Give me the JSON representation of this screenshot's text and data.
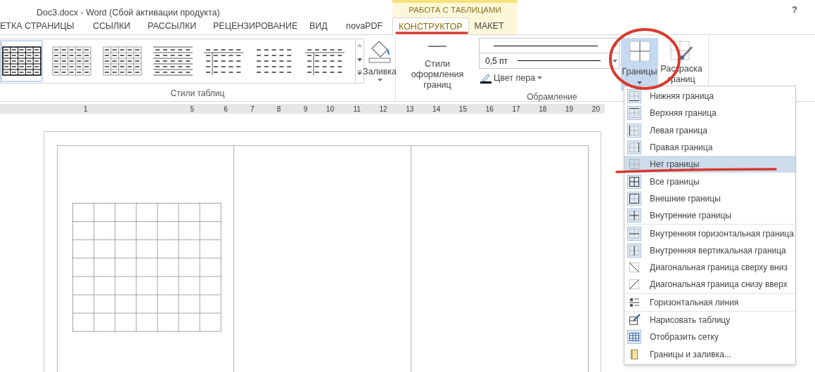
{
  "window": {
    "title": "Doc3.docx - Word (Сбой активации продукта)",
    "help": "?"
  },
  "tabs": [
    {
      "label": "ЕТКА СТРАНИЦЫ",
      "selected": false
    },
    {
      "label": "ССЫЛКИ",
      "selected": false
    },
    {
      "label": "РАССЫЛКИ",
      "selected": false
    },
    {
      "label": "РЕЦЕНЗИРОВАНИЕ",
      "selected": false
    },
    {
      "label": "ВИД",
      "selected": false
    },
    {
      "label": "novaPDF",
      "selected": false
    }
  ],
  "contextual_tabs": {
    "header": "РАБОТА С ТАБЛИЦАМИ",
    "tabs": [
      {
        "label": "КОНСТРУКТОР",
        "selected": true
      },
      {
        "label": "МАКЕТ",
        "selected": false
      }
    ]
  },
  "ribbon": {
    "table_styles": {
      "label": "Стили таблиц",
      "styles": [
        {
          "selected": true
        },
        {
          "selected": false
        },
        {
          "selected": false
        },
        {
          "selected": false
        },
        {
          "selected": false
        },
        {
          "selected": false
        },
        {
          "selected": false
        }
      ],
      "fill_button": "Заливка"
    },
    "borders_group": {
      "label": "Обрамление",
      "border_styles_button": "Стили оформления границ",
      "line_weight": "0,5 пт",
      "pen_color": "Цвет пера",
      "borders_button": "Границы",
      "border_painter": "Раскраска границ"
    }
  },
  "ruler": [
    "1",
    "5",
    "6",
    "7",
    "8",
    "9",
    "10",
    "11",
    "12",
    "13",
    "14",
    "15",
    "16",
    "17",
    "18",
    "19",
    "20"
  ],
  "menu": {
    "groups": [
      [
        {
          "label": "Нижняя граница",
          "kind": "bottom",
          "selected": false
        },
        {
          "label": "Верхняя граница",
          "kind": "top",
          "selected": false
        },
        {
          "label": "Левая граница",
          "kind": "left",
          "selected": false
        },
        {
          "label": "Правая граница",
          "kind": "right",
          "selected": false
        },
        {
          "label": "Нет границы",
          "kind": "none",
          "selected": true
        },
        {
          "label": "Все границы",
          "kind": "all",
          "selected": false
        },
        {
          "label": "Внешние границы",
          "kind": "outside",
          "selected": false
        },
        {
          "label": "Внутренние границы",
          "kind": "inside",
          "selected": false
        }
      ],
      [
        {
          "label": "Внутренняя горизонтальная граница",
          "kind": "ih",
          "selected": false
        },
        {
          "label": "Внутренняя вертикальная граница",
          "kind": "iv",
          "selected": false
        },
        {
          "label": "Диагональная граница сверху вниз",
          "kind": "dd",
          "selected": false
        },
        {
          "label": "Диагональная граница снизу вверх",
          "kind": "du",
          "selected": false
        }
      ],
      [
        {
          "label": "Горизонтальная линия",
          "kind": "hline",
          "selected": false
        }
      ],
      [
        {
          "label": "Нарисовать таблицу",
          "kind": "draw",
          "selected": false
        },
        {
          "label": "Отобразить сетку",
          "kind": "grid",
          "selected": false
        },
        {
          "label": "Границы и заливка...",
          "kind": "page",
          "selected": false
        }
      ]
    ]
  }
}
